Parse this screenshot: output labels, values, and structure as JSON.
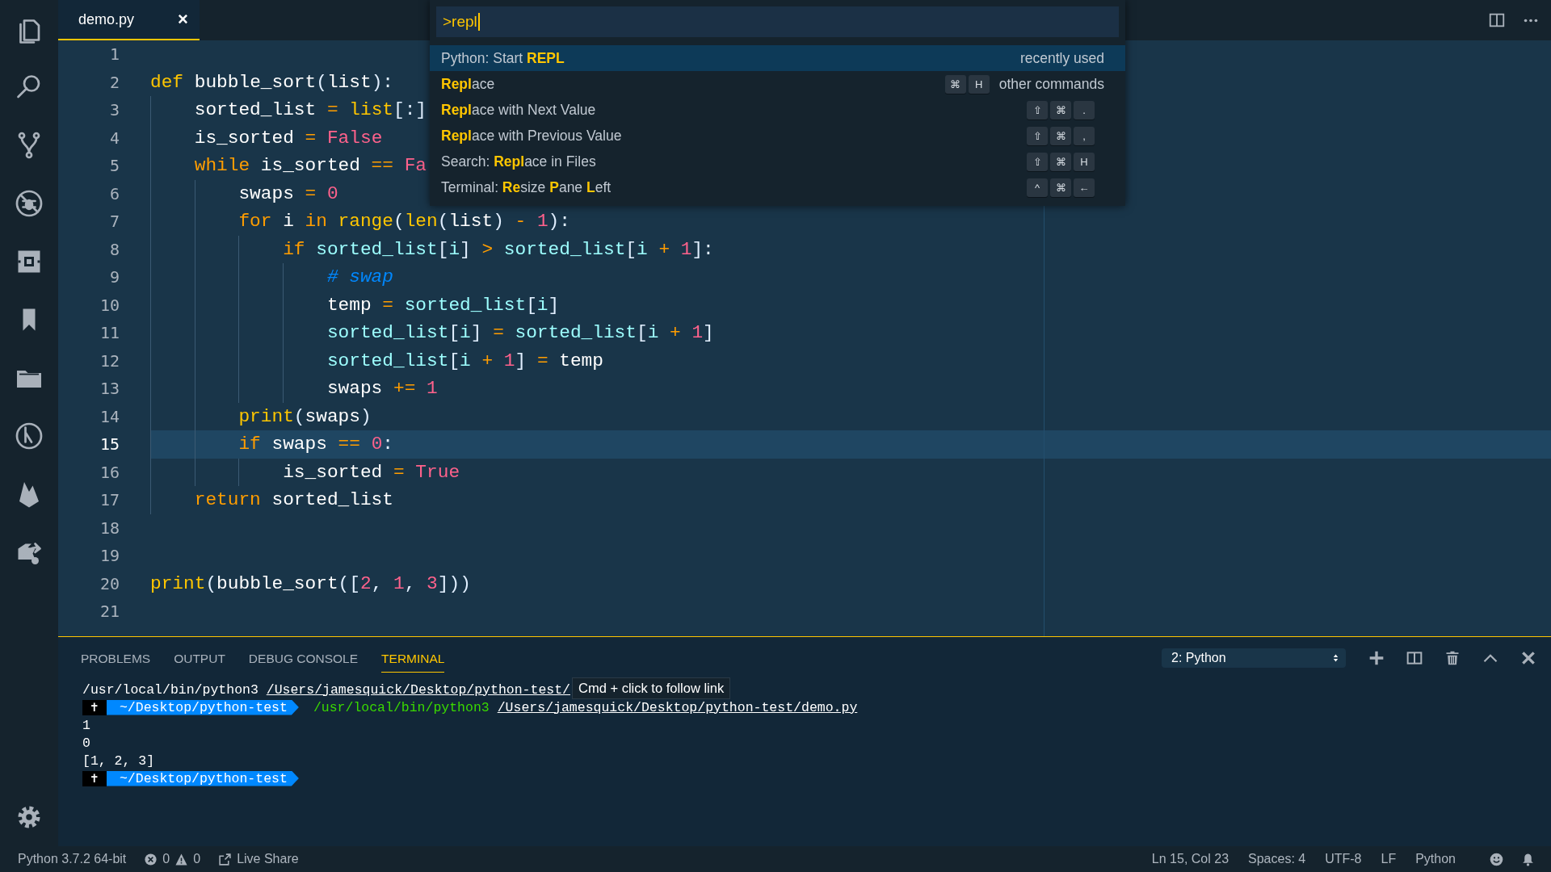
{
  "tabs": [
    {
      "label": "demo.py",
      "close": "×",
      "selected": true
    }
  ],
  "editor": {
    "lines": [
      {
        "number": "1",
        "current": false
      },
      {
        "number": "2",
        "current": false,
        "tokens": [
          {
            "kind": "storage",
            "text": "def"
          },
          {
            "kind": "plain",
            "text": " bubble_sort"
          },
          {
            "kind": "punct",
            "text": "("
          },
          {
            "kind": "plain",
            "text": "list"
          },
          {
            "kind": "punct",
            "text": "):"
          }
        ]
      },
      {
        "number": "3",
        "current": false,
        "tokens": [
          {
            "kind": "plain",
            "text": "    sorted_list "
          },
          {
            "kind": "op",
            "text": "= "
          },
          {
            "kind": "builtin",
            "text": "list"
          },
          {
            "kind": "punct",
            "text": "[:]"
          }
        ]
      },
      {
        "number": "4",
        "current": false,
        "tokens": [
          {
            "kind": "plain",
            "text": "    is_sorted "
          },
          {
            "kind": "op",
            "text": "= "
          },
          {
            "kind": "num",
            "text": "False"
          }
        ]
      },
      {
        "number": "5",
        "current": false,
        "tokens": [
          {
            "kind": "keyword",
            "text": "    while"
          },
          {
            "kind": "plain",
            "text": " is_sorted "
          },
          {
            "kind": "op",
            "text": "== "
          },
          {
            "kind": "num",
            "text": "Fa"
          }
        ]
      },
      {
        "number": "6",
        "current": false,
        "tokens": [
          {
            "kind": "plain",
            "text": "        swaps "
          },
          {
            "kind": "op",
            "text": "= "
          },
          {
            "kind": "num",
            "text": "0"
          }
        ]
      },
      {
        "number": "7",
        "current": false,
        "tokens": [
          {
            "kind": "keyword",
            "text": "        for"
          },
          {
            "kind": "plain",
            "text": " i "
          },
          {
            "kind": "keyword",
            "text": "in "
          },
          {
            "kind": "builtin",
            "text": "range"
          },
          {
            "kind": "punct",
            "text": "("
          },
          {
            "kind": "builtin",
            "text": "len"
          },
          {
            "kind": "punct",
            "text": "("
          },
          {
            "kind": "plain",
            "text": "list"
          },
          {
            "kind": "punct",
            "text": ") "
          },
          {
            "kind": "op",
            "text": "- "
          },
          {
            "kind": "num",
            "text": "1"
          },
          {
            "kind": "punct",
            "text": "):"
          }
        ]
      },
      {
        "number": "8",
        "current": false,
        "tokens": [
          {
            "kind": "keyword",
            "text": "            if "
          },
          {
            "kind": "prop",
            "text": "sorted_list"
          },
          {
            "kind": "punct",
            "text": "["
          },
          {
            "kind": "prop",
            "text": "i"
          },
          {
            "kind": "punct",
            "text": "] "
          },
          {
            "kind": "op",
            "text": "> "
          },
          {
            "kind": "prop",
            "text": "sorted_list"
          },
          {
            "kind": "punct",
            "text": "["
          },
          {
            "kind": "prop",
            "text": "i "
          },
          {
            "kind": "op",
            "text": "+ "
          },
          {
            "kind": "num",
            "text": "1"
          },
          {
            "kind": "punct",
            "text": "]:"
          }
        ]
      },
      {
        "number": "9",
        "current": false,
        "tokens": [
          {
            "kind": "comment",
            "text": "                # swap"
          }
        ]
      },
      {
        "number": "10",
        "current": false,
        "tokens": [
          {
            "kind": "plain",
            "text": "                temp "
          },
          {
            "kind": "op",
            "text": "= "
          },
          {
            "kind": "prop",
            "text": "sorted_list"
          },
          {
            "kind": "punct",
            "text": "["
          },
          {
            "kind": "prop",
            "text": "i"
          },
          {
            "kind": "punct",
            "text": "]"
          }
        ]
      },
      {
        "number": "11",
        "current": false,
        "tokens": [
          {
            "kind": "prop",
            "text": "                sorted_list"
          },
          {
            "kind": "punct",
            "text": "["
          },
          {
            "kind": "prop",
            "text": "i"
          },
          {
            "kind": "punct",
            "text": "] "
          },
          {
            "kind": "op",
            "text": "= "
          },
          {
            "kind": "prop",
            "text": "sorted_list"
          },
          {
            "kind": "punct",
            "text": "["
          },
          {
            "kind": "prop",
            "text": "i "
          },
          {
            "kind": "op",
            "text": "+ "
          },
          {
            "kind": "num",
            "text": "1"
          },
          {
            "kind": "punct",
            "text": "]"
          }
        ]
      },
      {
        "number": "12",
        "current": false,
        "tokens": [
          {
            "kind": "prop",
            "text": "                sorted_list"
          },
          {
            "kind": "punct",
            "text": "["
          },
          {
            "kind": "prop",
            "text": "i "
          },
          {
            "kind": "op",
            "text": "+ "
          },
          {
            "kind": "num",
            "text": "1"
          },
          {
            "kind": "punct",
            "text": "] "
          },
          {
            "kind": "op",
            "text": "= "
          },
          {
            "kind": "plain",
            "text": "temp"
          }
        ]
      },
      {
        "number": "13",
        "current": false,
        "tokens": [
          {
            "kind": "plain",
            "text": "                swaps "
          },
          {
            "kind": "op",
            "text": "+= "
          },
          {
            "kind": "num",
            "text": "1"
          }
        ]
      },
      {
        "number": "14",
        "current": false,
        "tokens": [
          {
            "kind": "builtin",
            "text": "        print"
          },
          {
            "kind": "punct",
            "text": "("
          },
          {
            "kind": "plain",
            "text": "swaps"
          },
          {
            "kind": "punct",
            "text": ")"
          }
        ]
      },
      {
        "number": "15",
        "current": true,
        "tokens": [
          {
            "kind": "keyword",
            "text": "        if"
          },
          {
            "kind": "plain",
            "text": " swaps "
          },
          {
            "kind": "op",
            "text": "== "
          },
          {
            "kind": "num",
            "text": "0"
          },
          {
            "kind": "punct",
            "text": ":"
          }
        ]
      },
      {
        "number": "16",
        "current": false,
        "tokens": [
          {
            "kind": "plain",
            "text": "            is_sorted "
          },
          {
            "kind": "op",
            "text": "= "
          },
          {
            "kind": "num",
            "text": "True"
          }
        ]
      },
      {
        "number": "17",
        "current": false,
        "tokens": [
          {
            "kind": "keyword",
            "text": "    return"
          },
          {
            "kind": "plain",
            "text": " sorted_list"
          }
        ]
      },
      {
        "number": "18",
        "current": false
      },
      {
        "number": "19",
        "current": false
      },
      {
        "number": "20",
        "current": false,
        "tokens": [
          {
            "kind": "builtin",
            "text": "print"
          },
          {
            "kind": "punct",
            "text": "("
          },
          {
            "kind": "plain",
            "text": "bubble_sort"
          },
          {
            "kind": "punct",
            "text": "(["
          },
          {
            "kind": "num",
            "text": "2"
          },
          {
            "kind": "punct",
            "text": ", "
          },
          {
            "kind": "num",
            "text": "1"
          },
          {
            "kind": "punct",
            "text": ", "
          },
          {
            "kind": "num",
            "text": "3"
          },
          {
            "kind": "punct",
            "text": "]))"
          }
        ]
      },
      {
        "number": "21",
        "current": false
      }
    ]
  },
  "command_palette": {
    "value": ">repl",
    "items": [
      {
        "label": "Python: Start **REPL**",
        "detail": "recently used",
        "selected": true
      },
      {
        "label": "**Repl**ace",
        "keys": [
          "⌘",
          "H"
        ],
        "detail": "other commands",
        "selected": false
      },
      {
        "label": "**Repl**ace with Next Value",
        "keys": [
          "⇧",
          "⌘",
          "."
        ],
        "selected": false
      },
      {
        "label": "**Repl**ace with Previous Value",
        "keys": [
          "⇧",
          "⌘",
          ","
        ],
        "selected": false
      },
      {
        "label": "Search: **Repl**ace in Files",
        "keys": [
          "⇧",
          "⌘",
          "H"
        ],
        "selected": false
      },
      {
        "label": "Terminal: **Re**size **P**ane **L**eft",
        "keys": [
          "^",
          "⌘",
          "←"
        ],
        "selected": false
      }
    ]
  },
  "panel": {
    "tabs": [
      {
        "label": "PROBLEMS",
        "selected": false
      },
      {
        "label": "OUTPUT",
        "selected": false
      },
      {
        "label": "DEBUG CONSOLE",
        "selected": false
      },
      {
        "label": "TERMINAL",
        "selected": true
      }
    ],
    "terminal_select": "2: Python",
    "terminal": {
      "tooltip": "Cmd + click to follow link",
      "lines": [
        {
          "segments": [
            {
              "kind": "plain",
              "text": "/usr/local/bin/python3 "
            },
            {
              "kind": "link",
              "text": "/Users/jamesquick/Desktop/python-test/"
            }
          ],
          "tooltip": true
        },
        {
          "segments": [
            {
              "kind": "symbol",
              "text": "✝"
            },
            {
              "kind": "path",
              "text": "~/Desktop/python-test"
            },
            {
              "kind": "command",
              "text": "/usr/local/bin/python3"
            },
            {
              "kind": "link",
              "text": "/Users/jamesquick/Desktop/python-test/demo.py"
            }
          ]
        },
        {
          "segments": [
            {
              "kind": "plain",
              "text": "1"
            }
          ]
        },
        {
          "segments": [
            {
              "kind": "plain",
              "text": "0"
            }
          ]
        },
        {
          "segments": [
            {
              "kind": "plain",
              "text": "[1, 2, 3]"
            }
          ]
        },
        {
          "segments": [
            {
              "kind": "symbol",
              "text": "✝"
            },
            {
              "kind": "path",
              "text": "~/Desktop/python-test"
            }
          ]
        }
      ]
    }
  },
  "status_bar": {
    "interpreter": "Python 3.7.2 64-bit",
    "errors": "0",
    "warnings": "0",
    "live_share": "Live Share",
    "right": [
      "Ln 15, Col 23",
      "Spaces: 4",
      "UTF-8",
      "LF",
      "Python"
    ]
  }
}
